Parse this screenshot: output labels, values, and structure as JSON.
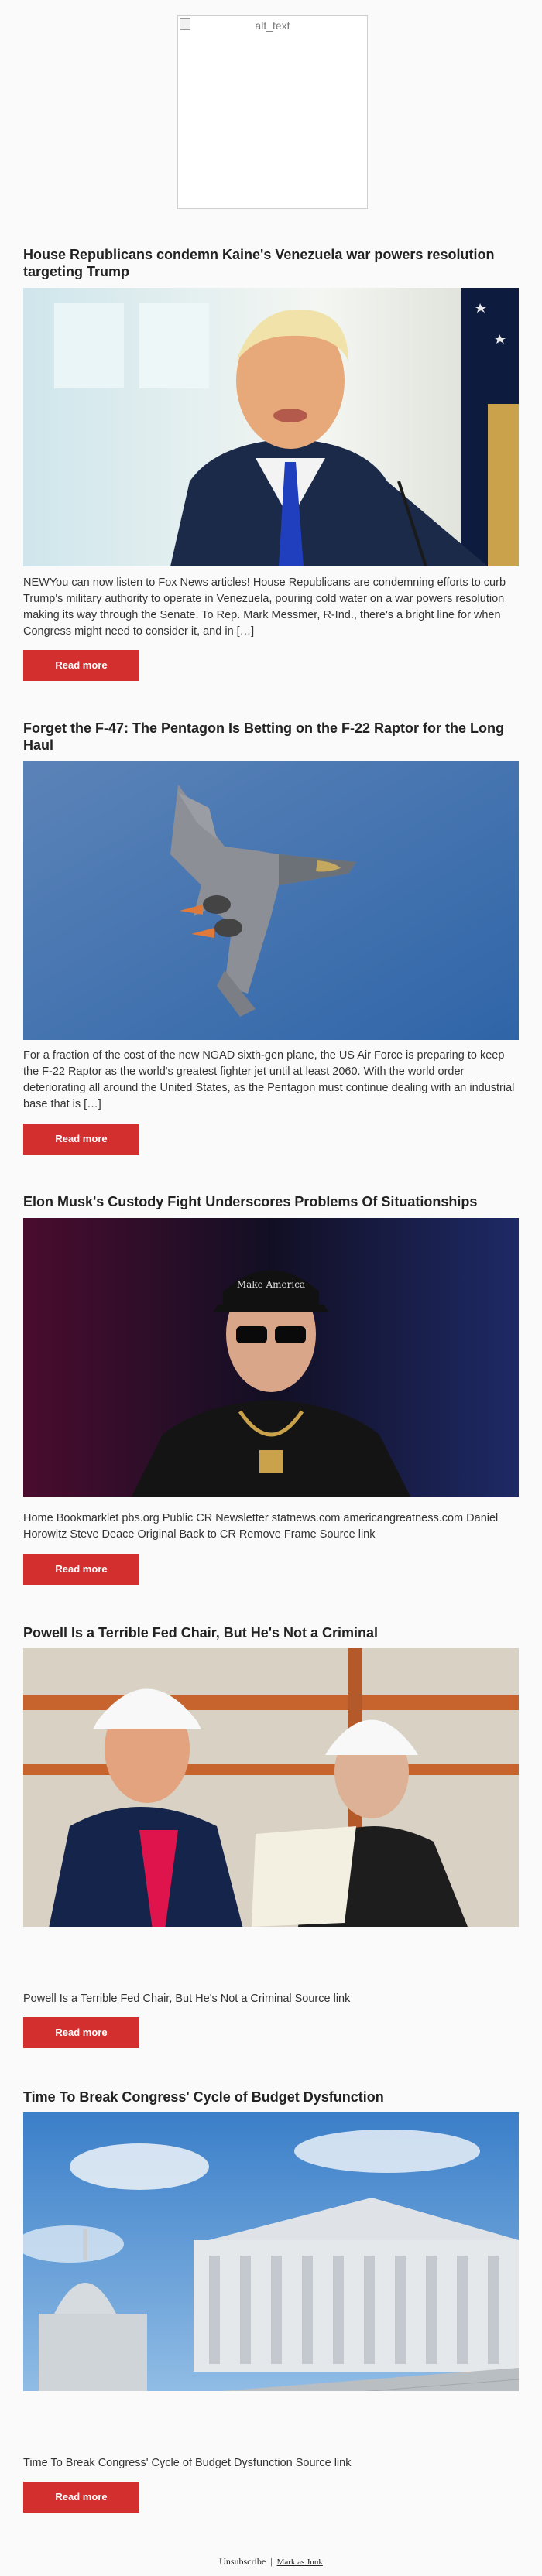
{
  "logo": {
    "alt": "alt_text"
  },
  "articles": [
    {
      "title": "House Republicans condemn Kaine's Venezuela war powers resolution targeting Trump",
      "image": "trump-speaking-photo",
      "summary": "NEWYou can now listen to Fox News articles! House Republicans are condemning efforts to curb Trump's military authority to operate in Venezuela, pouring cold water on a war powers resolution making its way through the Senate. To Rep. Mark Messmer, R-Ind., there's a bright line for when Congress might need to consider it, and in […]",
      "button": "Read more"
    },
    {
      "title": "Forget the F-47: The Pentagon Is Betting on the F-22 Raptor for the Long Haul",
      "image": "f22-raptor-photo",
      "summary": "For a fraction of the cost of the new NGAD sixth-gen plane, the US Air Force is preparing to keep the F-22 Raptor as the world's greatest fighter jet until at least 2060. With the world order deteriorating all around the United States, as the Pentagon must continue dealing with an industrial base that is […]",
      "button": "Read more"
    },
    {
      "title": "Elon Musk's Custody Fight Underscores Problems Of Situationships",
      "image": "elon-musk-photo",
      "summary": "Home Bookmarklet pbs.org Public CR Newsletter statnews.com americangreatness.com Daniel Horowitz Steve Deace Original Back to CR Remove Frame Source link",
      "button": "Read more"
    },
    {
      "title": "Powell Is a Terrible Fed Chair, But He's Not a Criminal",
      "image": "trump-powell-hardhats-photo",
      "summary": "Powell Is a Terrible Fed Chair, But He's Not a Criminal Source link",
      "button": "Read more"
    },
    {
      "title": "Time To Break Congress' Cycle of Budget Dysfunction",
      "image": "us-capitol-photo",
      "summary": "Time To Break Congress' Cycle of Budget Dysfunction Source link",
      "button": "Read more"
    }
  ],
  "footer": {
    "unsubscribe": "Unsubscribe",
    "separator": "|",
    "junk": "Mark as Junk"
  },
  "colors": {
    "button": "#d32f2f",
    "background": "#fafafa"
  }
}
